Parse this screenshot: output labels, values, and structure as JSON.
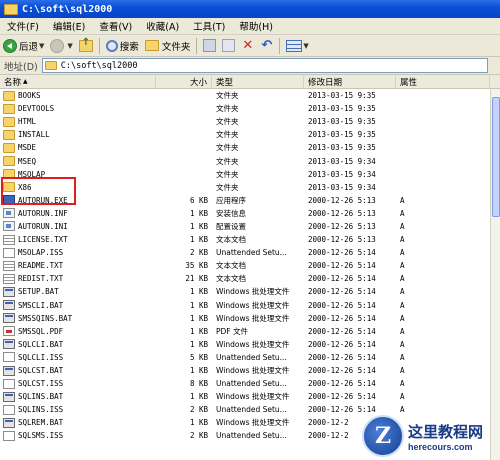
{
  "window": {
    "title": "C:\\soft\\sql2000"
  },
  "menu": [
    "文件(F)",
    "编辑(E)",
    "查看(V)",
    "收藏(A)",
    "工具(T)",
    "帮助(H)"
  ],
  "toolbar": {
    "back_label": "后退",
    "search_label": "搜索",
    "folders_label": "文件夹"
  },
  "address": {
    "label": "地址(D)",
    "value": "C:\\soft\\sql2000"
  },
  "columns": {
    "name": "名称",
    "size": "大小",
    "type": "类型",
    "date": "修改日期",
    "attr": "属性"
  },
  "files": [
    {
      "name": "BOOKS",
      "size": "",
      "type": "文件夹",
      "date": "2013-03-15 9:35",
      "attr": "",
      "icon": "folder-icon"
    },
    {
      "name": "DEVTOOLS",
      "size": "",
      "type": "文件夹",
      "date": "2013-03-15 9:35",
      "attr": "",
      "icon": "folder-icon"
    },
    {
      "name": "HTML",
      "size": "",
      "type": "文件夹",
      "date": "2013-03-15 9:35",
      "attr": "",
      "icon": "folder-icon"
    },
    {
      "name": "INSTALL",
      "size": "",
      "type": "文件夹",
      "date": "2013-03-15 9:35",
      "attr": "",
      "icon": "folder-icon"
    },
    {
      "name": "MSDE",
      "size": "",
      "type": "文件夹",
      "date": "2013-03-15 9:35",
      "attr": "",
      "icon": "folder-icon"
    },
    {
      "name": "MSEQ",
      "size": "",
      "type": "文件夹",
      "date": "2013-03-15 9:34",
      "attr": "",
      "icon": "folder-icon"
    },
    {
      "name": "MSOLAP",
      "size": "",
      "type": "文件夹",
      "date": "2013-03-15 9:34",
      "attr": "",
      "icon": "folder-icon"
    },
    {
      "name": "X86",
      "size": "",
      "type": "文件夹",
      "date": "2013-03-15 9:34",
      "attr": "",
      "icon": "folder-icon"
    },
    {
      "name": "AUTORUN.EXE",
      "size": "6 KB",
      "type": "应用程序",
      "date": "2000-12-26 5:13",
      "attr": "A",
      "icon": "app-icon"
    },
    {
      "name": "AUTORUN.INF",
      "size": "1 KB",
      "type": "安装信息",
      "date": "2000-12-26 5:13",
      "attr": "A",
      "icon": "ini-icon"
    },
    {
      "name": "AUTORUN.INI",
      "size": "1 KB",
      "type": "配置设置",
      "date": "2000-12-26 5:13",
      "attr": "A",
      "icon": "ini-icon"
    },
    {
      "name": "LICENSE.TXT",
      "size": "1 KB",
      "type": "文本文档",
      "date": "2000-12-26 5:13",
      "attr": "A",
      "icon": "txt-icon"
    },
    {
      "name": "MSOLAP.ISS",
      "size": "2 KB",
      "type": "Unattended Setu...",
      "date": "2000-12-26 5:14",
      "attr": "A",
      "icon": "iss-icon"
    },
    {
      "name": "README.TXT",
      "size": "35 KB",
      "type": "文本文档",
      "date": "2000-12-26 5:14",
      "attr": "A",
      "icon": "txt-icon"
    },
    {
      "name": "REDIST.TXT",
      "size": "21 KB",
      "type": "文本文档",
      "date": "2000-12-26 5:14",
      "attr": "A",
      "icon": "txt-icon"
    },
    {
      "name": "SETUP.BAT",
      "size": "1 KB",
      "type": "Windows 批处理文件",
      "date": "2000-12-26 5:14",
      "attr": "A",
      "icon": "bat-icon"
    },
    {
      "name": "SMSCLI.BAT",
      "size": "1 KB",
      "type": "Windows 批处理文件",
      "date": "2000-12-26 5:14",
      "attr": "A",
      "icon": "bat-icon"
    },
    {
      "name": "SMSSQINS.BAT",
      "size": "1 KB",
      "type": "Windows 批处理文件",
      "date": "2000-12-26 5:14",
      "attr": "A",
      "icon": "bat-icon"
    },
    {
      "name": "SMSSQL.PDF",
      "size": "1 KB",
      "type": "PDF 文件",
      "date": "2000-12-26 5:14",
      "attr": "A",
      "icon": "pdf-icon"
    },
    {
      "name": "SQLCLI.BAT",
      "size": "1 KB",
      "type": "Windows 批处理文件",
      "date": "2000-12-26 5:14",
      "attr": "A",
      "icon": "bat-icon"
    },
    {
      "name": "SQLCLI.ISS",
      "size": "5 KB",
      "type": "Unattended Setu...",
      "date": "2000-12-26 5:14",
      "attr": "A",
      "icon": "iss-icon"
    },
    {
      "name": "SQLCST.BAT",
      "size": "1 KB",
      "type": "Windows 批处理文件",
      "date": "2000-12-26 5:14",
      "attr": "A",
      "icon": "bat-icon"
    },
    {
      "name": "SQLCST.ISS",
      "size": "8 KB",
      "type": "Unattended Setu...",
      "date": "2000-12-26 5:14",
      "attr": "A",
      "icon": "iss-icon"
    },
    {
      "name": "SQLINS.BAT",
      "size": "1 KB",
      "type": "Windows 批处理文件",
      "date": "2000-12-26 5:14",
      "attr": "A",
      "icon": "bat-icon"
    },
    {
      "name": "SQLINS.ISS",
      "size": "2 KB",
      "type": "Unattended Setu...",
      "date": "2000-12-26 5:14",
      "attr": "A",
      "icon": "iss-icon"
    },
    {
      "name": "SQLREM.BAT",
      "size": "1 KB",
      "type": "Windows 批处理文件",
      "date": "2000-12-2",
      "attr": "",
      "icon": "bat-icon"
    },
    {
      "name": "SQLSMS.ISS",
      "size": "2 KB",
      "type": "Unattended Setu...",
      "date": "2000-12-2",
      "attr": "",
      "icon": "iss-icon"
    }
  ],
  "watermark": {
    "logo_letter": "Z",
    "title": "这里教程网",
    "url": "herecours.com"
  }
}
